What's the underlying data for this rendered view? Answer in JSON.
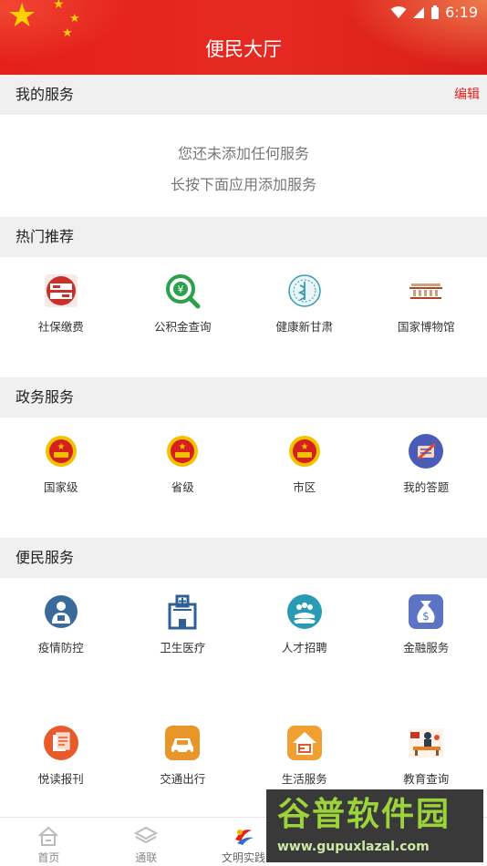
{
  "status_bar": {
    "time": "6:19"
  },
  "header": {
    "title": "便民大厅"
  },
  "my_services": {
    "title": "我的服务",
    "edit_label": "编辑",
    "empty_line1": "您还未添加任何服务",
    "empty_line2": "长按下面应用添加服务"
  },
  "hot": {
    "title": "热门推荐",
    "items": [
      {
        "label": "社保缴费",
        "icon": "social-security-icon"
      },
      {
        "label": "公积金查询",
        "icon": "fund-search-icon"
      },
      {
        "label": "健康新甘肃",
        "icon": "health-emblem-icon"
      },
      {
        "label": "国家博物馆",
        "icon": "museum-icon"
      }
    ]
  },
  "gov": {
    "title": "政务服务",
    "items": [
      {
        "label": "国家级",
        "icon": "national-emblem-icon"
      },
      {
        "label": "省级",
        "icon": "national-emblem-icon"
      },
      {
        "label": "市区",
        "icon": "national-emblem-icon"
      },
      {
        "label": "我的答题",
        "icon": "quiz-icon"
      }
    ]
  },
  "civil": {
    "title": "便民服务",
    "row1": [
      {
        "label": "疫情防控",
        "icon": "epidemic-icon"
      },
      {
        "label": "卫生医疗",
        "icon": "hospital-icon"
      },
      {
        "label": "人才招聘",
        "icon": "recruit-icon"
      },
      {
        "label": "金融服务",
        "icon": "money-bag-icon"
      }
    ],
    "row2": [
      {
        "label": "悦读报刊",
        "icon": "reading-icon"
      },
      {
        "label": "交通出行",
        "icon": "car-icon"
      },
      {
        "label": "生活服务",
        "icon": "home-icon"
      },
      {
        "label": "教育查询",
        "icon": "education-icon"
      }
    ]
  },
  "bottom_nav": [
    {
      "label": "首页",
      "icon": "home-nav-icon"
    },
    {
      "label": "通联",
      "icon": "layers-icon"
    },
    {
      "label": "文明实践",
      "icon": "civilization-icon"
    }
  ],
  "watermark": {
    "name": "谷普软件园",
    "url": "www.gupuxlazal.com"
  },
  "colors": {
    "brand": "#e5201b",
    "section_bg": "#f0f0f0"
  }
}
